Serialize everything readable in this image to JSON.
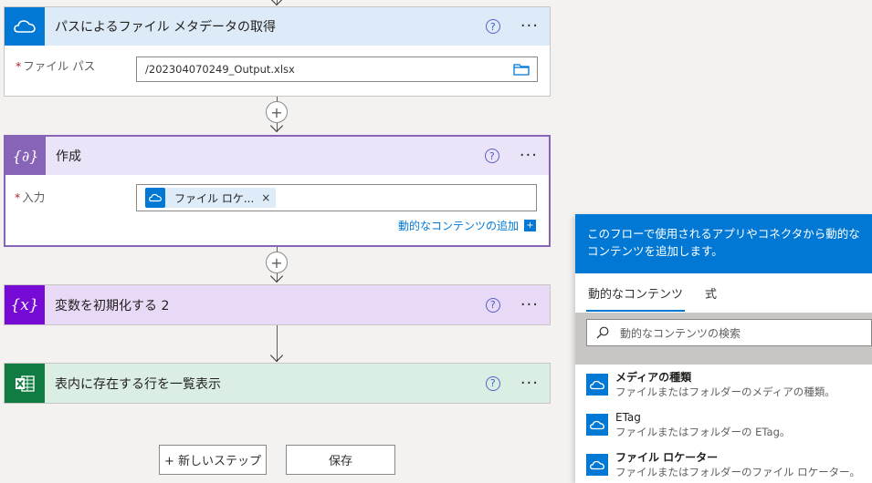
{
  "steps": {
    "get_metadata": {
      "title": "パスによるファイル メタデータの取得",
      "field_label": "ファイル パス",
      "field_value": "/202304070249_Output.xlsx"
    },
    "compose": {
      "title": "作成",
      "field_label": "入力",
      "token_label": "ファイル ロケ...",
      "dynamic_link": "動的なコンテンツの追加"
    },
    "init_variable": {
      "title": "変数を初期化する 2",
      "icon_text": "{x}"
    },
    "list_rows": {
      "title": "表内に存在する行を一覧表示"
    }
  },
  "common": {
    "required_mark": "*",
    "help_glyph": "?",
    "more_glyph": "···",
    "plus_glyph": "+",
    "close_glyph": "×"
  },
  "buttons": {
    "new_step": "+ 新しいステップ",
    "save": "保存"
  },
  "panel": {
    "header": "このフローで使用されるアプリやコネクタから動的なコンテンツを追加します。",
    "tabs": [
      {
        "label": "動的なコンテンツ",
        "active": true
      },
      {
        "label": "式",
        "active": false
      }
    ],
    "search_placeholder": "動的なコンテンツの検索",
    "items": [
      {
        "title": "メディアの種類",
        "desc": "ファイルまたはフォルダーのメディアの種類。"
      },
      {
        "title": "ETag",
        "desc": "ファイルまたはフォルダーの ETag。"
      },
      {
        "title": "ファイル ロケーター",
        "desc": "ファイルまたはフォルダーのファイル ロケーター。"
      }
    ]
  },
  "colors": {
    "onedrive": "#0078d4",
    "compose": "#8764b8",
    "variable": "#770bd6",
    "excel": "#107c41"
  }
}
